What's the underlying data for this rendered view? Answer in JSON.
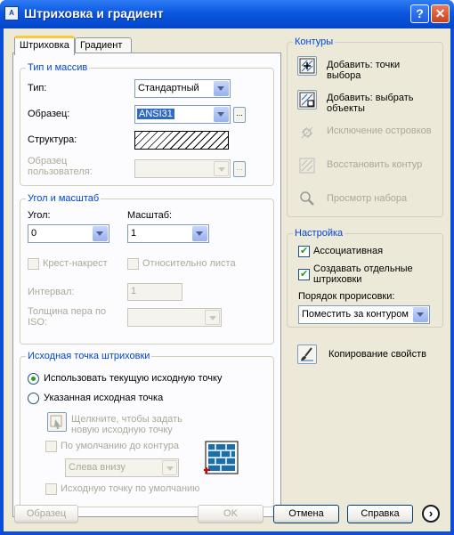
{
  "window": {
    "title": "Штриховка и градиент",
    "help_glyph": "?",
    "close_glyph": "✕"
  },
  "tabs": [
    {
      "label": "Штриховка",
      "active": true
    },
    {
      "label": "Градиент",
      "active": false
    }
  ],
  "type_pattern": {
    "legend": "Тип и массив",
    "type_label": "Тип:",
    "type_value": "Стандартный",
    "pattern_label": "Образец:",
    "pattern_value": "ANSI31",
    "browse_glyph": "...",
    "structure_label": "Структура:",
    "custom_label": "Образец пользователя:"
  },
  "angle_scale": {
    "legend": "Угол и масштаб",
    "angle_label": "Угол:",
    "angle_value": "0",
    "scale_label": "Масштаб:",
    "scale_value": "1",
    "double_label": "Крест-накрест",
    "relative_label": "Относительно листа",
    "spacing_label": "Интервал:",
    "spacing_value": "1",
    "pen_label": "Толщина пера по ISO:"
  },
  "origin": {
    "legend": "Исходная точка штриховки",
    "current_label": "Использовать текущую исходную точку",
    "specified_label": "Указанная исходная точка",
    "click_label": "Щелкните, чтобы задать новую исходную точку",
    "default_boundary_label": "По умолчанию до контура",
    "position_value": "Слева внизу",
    "store_default_label": "Исходную точку по умолчанию"
  },
  "boundaries": {
    "legend": "Контуры",
    "pick_points": "Добавить: точки выбора",
    "select_objects": "Добавить: выбрать объекты",
    "remove_islands": "Исключение островков",
    "recreate_boundary": "Восстановить контур",
    "view_selections": "Просмотр набора"
  },
  "options": {
    "legend": "Настройка",
    "associative_label": "Ассоциативная",
    "separate_label": "Создавать отдельные штриховки",
    "draw_order_label": "Порядок прорисовки:",
    "draw_order_value": "Поместить за контуром"
  },
  "inherit_label": "Копирование свойств",
  "footer": {
    "preview": "Образец",
    "ok": "OK",
    "cancel": "Отмена",
    "help": "Справка",
    "more_glyph": "›"
  }
}
